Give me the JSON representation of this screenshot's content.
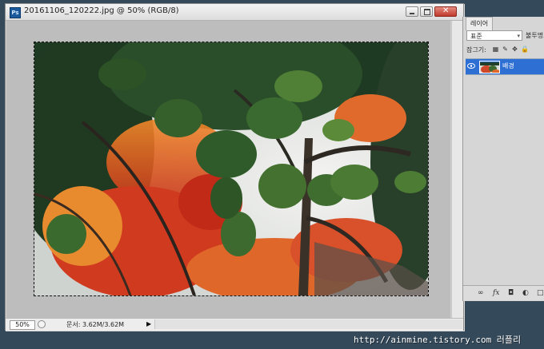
{
  "document": {
    "title": "20161106_120222.jpg @ 50% (RGB/8)",
    "app_icon": "Ps",
    "zoom": "50%",
    "doc_size": "문서: 3.62M/3.62M",
    "status_menu_arrow": "▶"
  },
  "window_controls": {
    "minimize": "minimize-icon",
    "maximize": "maximize-icon",
    "close_glyph": "✕"
  },
  "layers_panel": {
    "tab_label": "레이어",
    "blend_mode": "표준",
    "blend_arrow": "▾",
    "opacity_label": "불투명도",
    "lock_label": "잠그기:",
    "lock_icons": [
      "▦",
      "✎",
      "✥",
      "🔒"
    ],
    "layer": {
      "name": "배경",
      "visible": true
    },
    "footer_icons": [
      "∞",
      "fx",
      "◘",
      "◐",
      "□"
    ]
  },
  "watermark": "http://ainmine.tistory.com 러플리",
  "colors": {
    "selection_blue": "#2e6fd4",
    "desktop": "#34495a",
    "canvas_bg": "#bdbdbd"
  }
}
